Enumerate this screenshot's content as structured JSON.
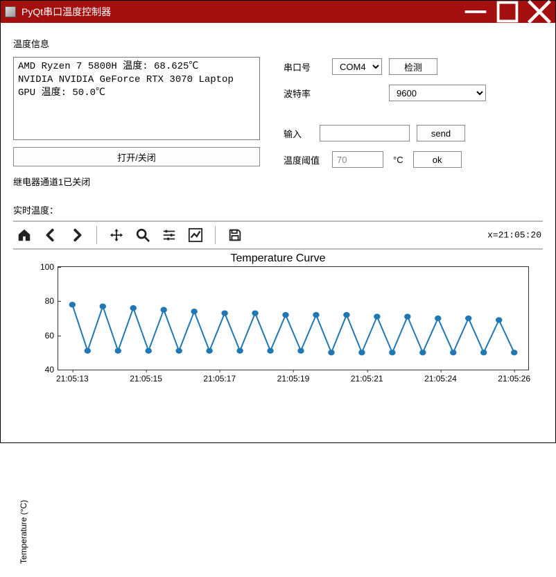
{
  "window": {
    "title": "PyQt串口温度控制器"
  },
  "labels": {
    "temp_info": "温度信息",
    "serial_port": "串口号",
    "detect": "检测",
    "baud_rate": "波特率",
    "input": "输入",
    "send": "send",
    "threshold": "温度阈值",
    "degc": "°C",
    "ok": "ok",
    "open_close": "打开/关闭",
    "relay_status": "继电器通道1已关闭",
    "realtime_temp": "实时温度："
  },
  "info_text": "AMD Ryzen 7 5800H 温度: 68.625℃\nNVIDIA NVIDIA GeForce RTX 3070 Laptop GPU 温度: 50.0℃",
  "serial": {
    "selected_port": "COM4",
    "selected_baud": "9600"
  },
  "input_value": "",
  "threshold_value": "70",
  "toolbar_coord": "x=21:05:20",
  "chart_data": {
    "type": "line",
    "title": "Temperature Curve",
    "ylabel": "Temperature (°C)",
    "ylim": [
      40,
      100
    ],
    "yticks": [
      40,
      60,
      80,
      100
    ],
    "xticks": [
      "21:05:13",
      "21:05:15",
      "21:05:17",
      "21:05:19",
      "21:05:21",
      "21:05:24",
      "21:05:26"
    ],
    "x": [
      0,
      1,
      2,
      3,
      4,
      5,
      6,
      7,
      8,
      9,
      10,
      11,
      12,
      13,
      14,
      15,
      16,
      17,
      18,
      19,
      20,
      21,
      22,
      23,
      24,
      25,
      26,
      27,
      28,
      29
    ],
    "values": [
      78,
      51,
      77,
      51,
      76,
      51,
      75,
      51,
      74,
      51,
      73,
      51,
      73,
      51,
      72,
      51,
      72,
      50,
      72,
      50,
      71,
      50,
      71,
      50,
      70,
      50,
      70,
      50,
      69,
      50
    ]
  }
}
